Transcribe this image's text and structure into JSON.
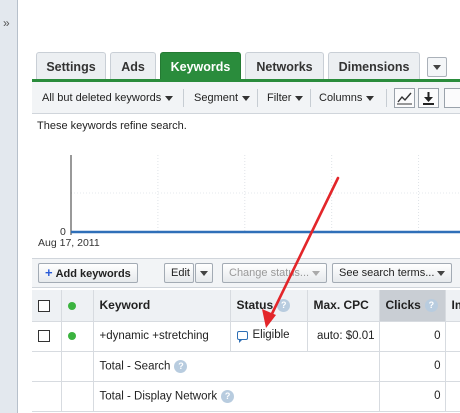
{
  "sidebar": {
    "expand_glyph": "»"
  },
  "tabs": [
    {
      "label": "Settings",
      "active": false
    },
    {
      "label": "Ads",
      "active": false
    },
    {
      "label": "Keywords",
      "active": true
    },
    {
      "label": "Networks",
      "active": false
    },
    {
      "label": "Dimensions",
      "active": false
    }
  ],
  "toolbar": {
    "filter_view": "All but deleted keywords",
    "segment": "Segment",
    "filter": "Filter",
    "columns": "Columns",
    "icons": [
      "line-chart-icon",
      "download-icon"
    ]
  },
  "description": "These keywords refine search.",
  "chart": {
    "date_label": "Aug 17, 2011",
    "zero_label": "0"
  },
  "chart_data": {
    "type": "line",
    "x": [
      "Aug 17, 2011"
    ],
    "series": [
      {
        "values": [
          0
        ]
      }
    ],
    "ylim": [
      0,
      null
    ],
    "grid": true
  },
  "actions": {
    "add_keywords": "Add keywords",
    "edit": "Edit",
    "change_status": "Change status...",
    "search_terms": "See search terms..."
  },
  "table": {
    "headers": {
      "keyword": "Keyword",
      "status": "Status",
      "max_cpc": "Max. CPC",
      "clicks": "Clicks",
      "impr": "Im"
    },
    "rows": [
      {
        "keyword": "+dynamic +stretching",
        "status": "Eligible",
        "max_cpc": "auto: $0.01",
        "clicks": "0"
      }
    ],
    "totals": [
      {
        "label": "Total - Search",
        "clicks": "0"
      },
      {
        "label": "Total - Display Network",
        "clicks": "0"
      }
    ]
  },
  "colors": {
    "active_tab": "#2a8c3c",
    "chart_line": "#2f6fb8",
    "annotation_arrow": "#e3262a",
    "status_dot": "#3bb33f"
  }
}
